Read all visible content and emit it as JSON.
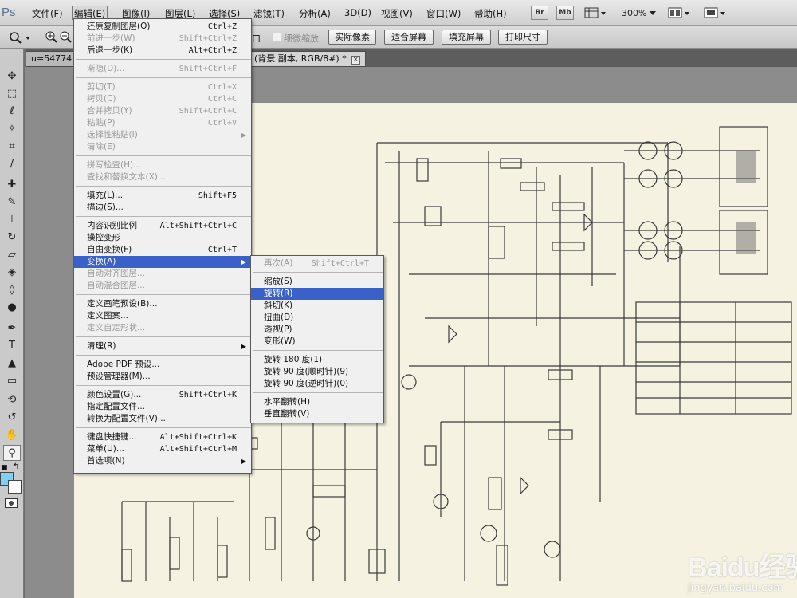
{
  "app": {
    "logo": "Ps"
  },
  "menubar": {
    "items": [
      "文件(F)",
      "编辑(E)",
      "图像(I)",
      "图层(L)",
      "选择(S)",
      "滤镜(T)",
      "分析(A)",
      "3D(D)",
      "视图(V)",
      "窗口(W)",
      "帮助(H)"
    ],
    "bridge": "Br",
    "minibridge": "Mb",
    "zoom": "300%"
  },
  "options": {
    "window_suffix": "口",
    "scrubby_zoom": "细微缩放",
    "buttons": [
      "实际像素",
      "适合屏幕",
      "填充屏幕",
      "打印尺寸"
    ]
  },
  "tabs": {
    "first": "u=54774",
    "second": "(背景 副本, RGB/8#) *",
    "close": "×"
  },
  "edit_menu": {
    "groups": [
      [
        {
          "label": "还原复制图层(O)",
          "shortcut": "Ctrl+Z",
          "disabled": false
        },
        {
          "label": "前进一步(W)",
          "shortcut": "Shift+Ctrl+Z",
          "disabled": true
        },
        {
          "label": "后退一步(K)",
          "shortcut": "Alt+Ctrl+Z",
          "disabled": false
        }
      ],
      [
        {
          "label": "渐隐(D)...",
          "shortcut": "Shift+Ctrl+F",
          "disabled": true
        }
      ],
      [
        {
          "label": "剪切(T)",
          "shortcut": "Ctrl+X",
          "disabled": true
        },
        {
          "label": "拷贝(C)",
          "shortcut": "Ctrl+C",
          "disabled": true
        },
        {
          "label": "合并拷贝(Y)",
          "shortcut": "Shift+Ctrl+C",
          "disabled": true
        },
        {
          "label": "粘贴(P)",
          "shortcut": "Ctrl+V",
          "disabled": true
        },
        {
          "label": "选择性粘贴(I)",
          "shortcut": "",
          "disabled": true,
          "submenu": true
        },
        {
          "label": "清除(E)",
          "shortcut": "",
          "disabled": true
        }
      ],
      [
        {
          "label": "拼写检查(H)...",
          "shortcut": "",
          "disabled": true
        },
        {
          "label": "查找和替换文本(X)...",
          "shortcut": "",
          "disabled": true
        }
      ],
      [
        {
          "label": "填充(L)...",
          "shortcut": "Shift+F5",
          "disabled": false
        },
        {
          "label": "描边(S)...",
          "shortcut": "",
          "disabled": false
        }
      ],
      [
        {
          "label": "内容识别比例",
          "shortcut": "Alt+Shift+Ctrl+C",
          "disabled": false
        },
        {
          "label": "操控变形",
          "shortcut": "",
          "disabled": false
        },
        {
          "label": "自由变换(F)",
          "shortcut": "Ctrl+T",
          "disabled": false
        },
        {
          "label": "变换(A)",
          "shortcut": "",
          "disabled": false,
          "submenu": true,
          "highlighted": true
        },
        {
          "label": "自动对齐图层...",
          "shortcut": "",
          "disabled": true
        },
        {
          "label": "自动混合图层...",
          "shortcut": "",
          "disabled": true
        }
      ],
      [
        {
          "label": "定义画笔预设(B)...",
          "shortcut": "",
          "disabled": false
        },
        {
          "label": "定义图案...",
          "shortcut": "",
          "disabled": false
        },
        {
          "label": "定义自定形状...",
          "shortcut": "",
          "disabled": true
        }
      ],
      [
        {
          "label": "清理(R)",
          "shortcut": "",
          "disabled": false,
          "submenu": true
        }
      ],
      [
        {
          "label": "Adobe PDF 预设...",
          "shortcut": "",
          "disabled": false
        },
        {
          "label": "预设管理器(M)...",
          "shortcut": "",
          "disabled": false
        }
      ],
      [
        {
          "label": "颜色设置(G)...",
          "shortcut": "Shift+Ctrl+K",
          "disabled": false
        },
        {
          "label": "指定配置文件...",
          "shortcut": "",
          "disabled": false
        },
        {
          "label": "转换为配置文件(V)...",
          "shortcut": "",
          "disabled": false
        }
      ],
      [
        {
          "label": "键盘快捷键...",
          "shortcut": "Alt+Shift+Ctrl+K",
          "disabled": false
        },
        {
          "label": "菜单(U)...",
          "shortcut": "Alt+Shift+Ctrl+M",
          "disabled": false
        },
        {
          "label": "首选项(N)",
          "shortcut": "",
          "disabled": false,
          "submenu": true
        }
      ]
    ]
  },
  "transform_menu": {
    "groups": [
      [
        {
          "label": "再次(A)",
          "shortcut": "Shift+Ctrl+T",
          "disabled": true
        }
      ],
      [
        {
          "label": "缩放(S)",
          "shortcut": "",
          "disabled": false
        },
        {
          "label": "旋转(R)",
          "shortcut": "",
          "disabled": false,
          "highlighted": true
        },
        {
          "label": "斜切(K)",
          "shortcut": "",
          "disabled": false
        },
        {
          "label": "扭曲(D)",
          "shortcut": "",
          "disabled": false
        },
        {
          "label": "透视(P)",
          "shortcut": "",
          "disabled": false
        },
        {
          "label": "变形(W)",
          "shortcut": "",
          "disabled": false
        }
      ],
      [
        {
          "label": "旋转 180 度(1)",
          "shortcut": "",
          "disabled": false
        },
        {
          "label": "旋转 90 度(顺时针)(9)",
          "shortcut": "",
          "disabled": false
        },
        {
          "label": "旋转 90 度(逆时针)(0)",
          "shortcut": "",
          "disabled": false
        }
      ],
      [
        {
          "label": "水平翻转(H)",
          "shortcut": "",
          "disabled": false
        },
        {
          "label": "垂直翻转(V)",
          "shortcut": "",
          "disabled": false
        }
      ]
    ]
  },
  "watermark": {
    "logo": "Baidu经验",
    "url": "jingyan.baidu.com"
  }
}
